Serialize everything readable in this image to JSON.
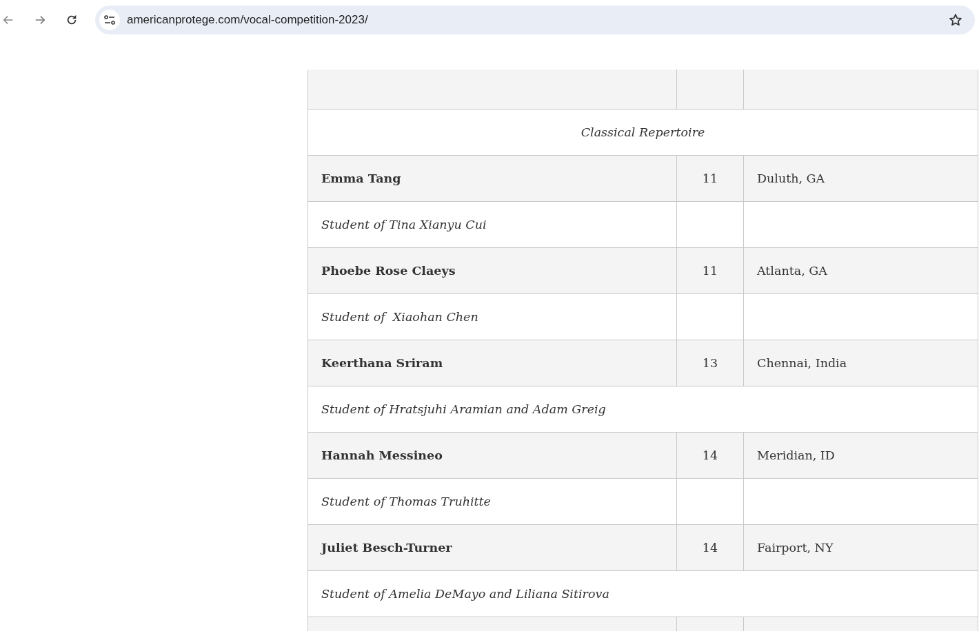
{
  "browser": {
    "url": "americanprotege.com/vocal-competition-2023/"
  },
  "table": {
    "rows": [
      {
        "kind": "blank"
      },
      {
        "kind": "section",
        "text": "Classical Repertoire"
      },
      {
        "kind": "performer",
        "name": "Emma Tang",
        "age": "11",
        "hometown": "Duluth, GA"
      },
      {
        "kind": "teacher",
        "text": "Student of Tina Xianyu Cui",
        "merged": false
      },
      {
        "kind": "performer",
        "name": "Phoebe Rose Claeys",
        "age": "11",
        "hometown": "Atlanta, GA"
      },
      {
        "kind": "teacher",
        "text": "Student of  Xiaohan Chen",
        "merged": false
      },
      {
        "kind": "performer",
        "name": "Keerthana Sriram",
        "age": "13",
        "hometown": "Chennai, India"
      },
      {
        "kind": "teacher",
        "text": "Student of Hratsjuhi Aramian and Adam Greig",
        "merged": true
      },
      {
        "kind": "performer",
        "name": "Hannah Messineo",
        "age": "14",
        "hometown": "Meridian, ID"
      },
      {
        "kind": "teacher",
        "text": "Student of Thomas Truhitte",
        "merged": false
      },
      {
        "kind": "performer",
        "name": "Juliet Besch-Turner",
        "age": "14",
        "hometown": "Fairport, NY"
      },
      {
        "kind": "teacher",
        "text": "Student of Amelia DeMayo and Liliana Sitirova",
        "merged": true
      },
      {
        "kind": "blank"
      }
    ]
  }
}
